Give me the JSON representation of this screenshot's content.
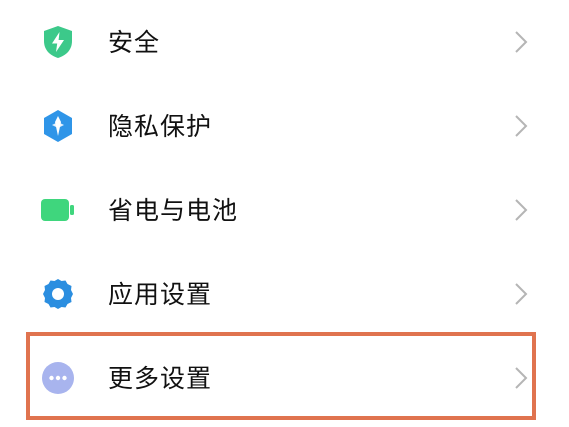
{
  "settings": {
    "items": [
      {
        "label": "安全",
        "icon": "shield-lightning-icon",
        "color": "#3cc98a"
      },
      {
        "label": "隐私保护",
        "icon": "privacy-icon",
        "color": "#2f95e8"
      },
      {
        "label": "省电与电池",
        "icon": "battery-icon",
        "color": "#3fd67d"
      },
      {
        "label": "应用设置",
        "icon": "gear-icon",
        "color": "#2b8ee0"
      },
      {
        "label": "更多设置",
        "icon": "more-dots-icon",
        "color": "#a8b4ee"
      }
    ],
    "chevron_icon": "chevron-right-icon",
    "highlight_color": "#e0734f"
  }
}
